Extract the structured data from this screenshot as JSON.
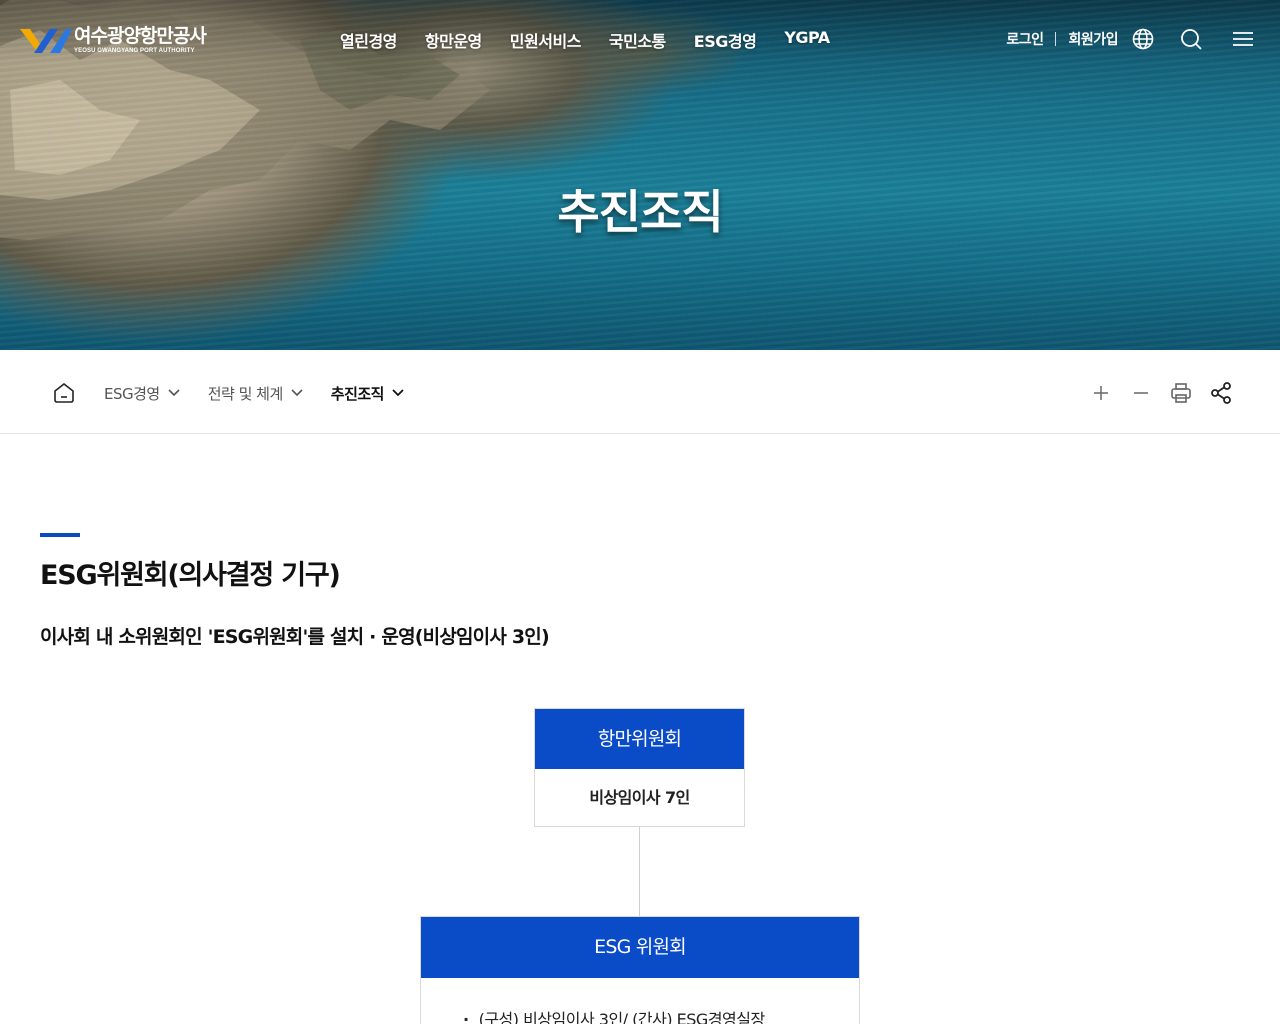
{
  "header": {
    "logo": {
      "name_kr": "여수광양항만공사",
      "name_en": "YEOSU GWANGYANG PORT AUTHORITY"
    },
    "gnb": [
      "열린경영",
      "항만운영",
      "민원서비스",
      "국민소통",
      "ESG경영",
      "YGPA"
    ],
    "util": {
      "login": "로그인",
      "join": "회원가입"
    }
  },
  "hero": {
    "title": "추진조직"
  },
  "breadcrumb": {
    "items": [
      {
        "label": "ESG경영"
      },
      {
        "label": "전략 및 체계"
      },
      {
        "label": "추진조직"
      }
    ]
  },
  "content": {
    "section_title": "ESG위원회(의사결정 기구)",
    "section_desc": "이사회 내 소위원회인 'ESG위원회'를 설치 · 운영(비상임이사 3인)",
    "org": {
      "top": {
        "title": "항만위원회",
        "body": "비상임이사 7인"
      },
      "main": {
        "title": "ESG 위원회",
        "items": [
          "(구성) 비상임이사 3인/ (간사) ESG경영실장"
        ]
      }
    }
  },
  "colors": {
    "accent_blue": "#0a4bc8",
    "divider": "#e6e6e6"
  }
}
